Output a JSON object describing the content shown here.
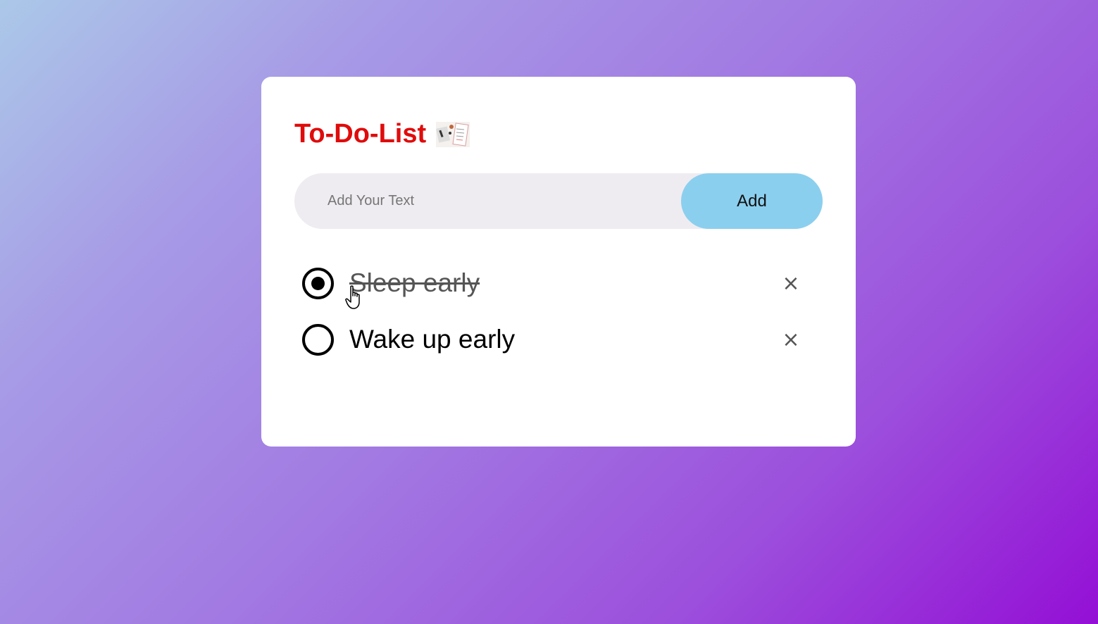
{
  "app": {
    "title": "To-Do-List",
    "title_icon": "checklist-notepad-icon",
    "title_color": "#e00b0b"
  },
  "input": {
    "value": "",
    "placeholder": "Add Your Text",
    "add_label": "Add",
    "add_color": "#8bcfee"
  },
  "tasks": [
    {
      "text": "Sleep early",
      "checked": true,
      "delete_icon": "close-icon",
      "delete_label": "×"
    },
    {
      "text": "Wake up early",
      "checked": false,
      "delete_icon": "close-icon",
      "delete_label": "×"
    }
  ]
}
